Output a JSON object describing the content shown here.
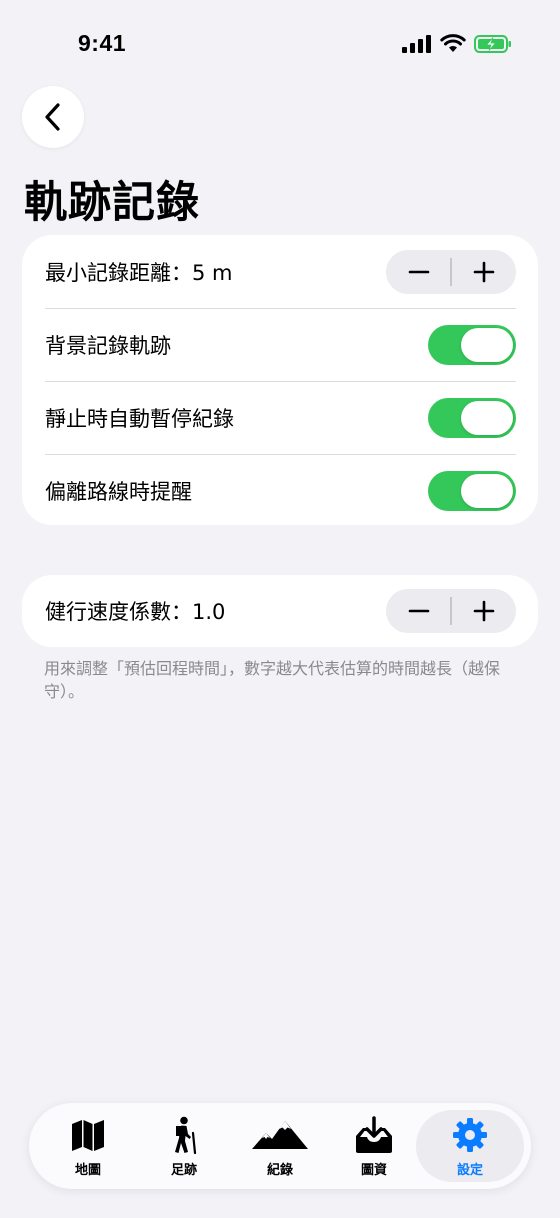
{
  "status_bar": {
    "time": "9:41"
  },
  "header": {
    "title": "軌跡記錄"
  },
  "settings": {
    "min_distance_label": "最小記錄距離：5 m",
    "background_label": "背景記錄軌跡",
    "background_on": true,
    "auto_pause_label": "靜止時自動暫停紀錄",
    "auto_pause_on": true,
    "off_route_label": "偏離路線時提醒",
    "off_route_on": true,
    "speed_factor_label": "健行速度係數：1.0"
  },
  "footnote": "用來調整「預估回程時間」，數字越大代表估算的時間越長（越保守）。",
  "tabs": [
    {
      "label": "地圖",
      "icon": "map-icon"
    },
    {
      "label": "足跡",
      "icon": "hiker-icon"
    },
    {
      "label": "紀錄",
      "icon": "mountains-icon"
    },
    {
      "label": "圖資",
      "icon": "download-tray-icon"
    },
    {
      "label": "設定",
      "icon": "gear-icon",
      "active": true
    }
  ],
  "colors": {
    "accent": "#0a7cff",
    "toggle_on": "#34c759",
    "background": "#f2f2f7",
    "battery": "#34c759"
  }
}
